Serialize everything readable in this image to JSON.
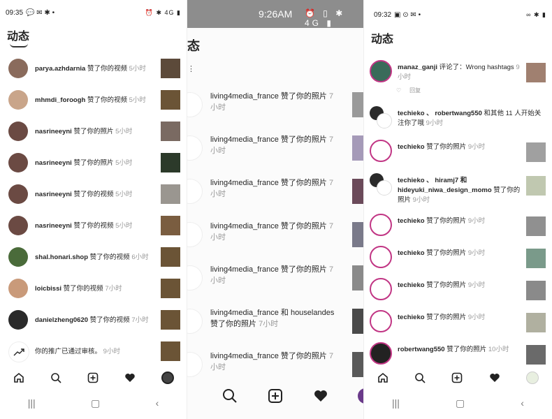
{
  "p1": {
    "status_time": "09:35",
    "status_right": "⏰ ✱ 4G ▮",
    "title": "动态",
    "rows": [
      {
        "user": "parya.azhdarnia",
        "action": "赞了你的视频",
        "time": "5小时",
        "av": "#8a6b5c",
        "img": "#5c4a3a"
      },
      {
        "user": "mhmdi_foroogh",
        "action": "赞了你的视频",
        "time": "5小时",
        "av": "#c9a58a",
        "img": "#6b5436"
      },
      {
        "user": "nasrineeyni",
        "action": "赞了你的照片",
        "time": "5小时",
        "av": "#6b4a43",
        "img": "#7a6a62"
      },
      {
        "user": "nasrineeyni",
        "action": "赞了你的照片",
        "time": "5小时",
        "av": "#6b4a43",
        "img": "#2c3a2a"
      },
      {
        "user": "nasrineeyni",
        "action": "赞了你的视频",
        "time": "5小时",
        "av": "#6b4a43",
        "img": "#9a9690"
      },
      {
        "user": "nasrineeyni",
        "action": "赞了你的视频",
        "time": "5小时",
        "av": "#6b4a43",
        "img": "#7a5d40"
      },
      {
        "user": "shal.honari.shop",
        "action": "赞了你的视频",
        "time": "6小时",
        "av": "#4a6b3a",
        "img": "#6b5436"
      },
      {
        "user": "loicbissi",
        "action": "赞了你的视频",
        "time": "7小时",
        "av": "#c99a7a",
        "img": "#6b5436"
      },
      {
        "user": "danielzheng0620",
        "action": "赞了你的视频",
        "time": "7小时",
        "av": "#2a2a2a",
        "img": "#6b5436"
      },
      {
        "user": "",
        "action": "你的推广已通过审核。",
        "time": "9小时",
        "av": "#ffffff",
        "img": "#6b5436"
      }
    ]
  },
  "p2": {
    "status_time": "9:26AM",
    "status_icons": "⏰ ▯ ✱ 4G ▮",
    "title": "态",
    "rows": [
      {
        "user": "living4media_france",
        "action": "赞了你的照片",
        "time": "7小时",
        "img": "#9a9a9a"
      },
      {
        "user": "living4media_france",
        "action": "赞了你的照片",
        "time": "7小时",
        "img": "#a59ab8"
      },
      {
        "user": "living4media_france",
        "action": "赞了你的照片",
        "time": "7小时",
        "img": "#6b4a5a"
      },
      {
        "user": "living4media_france",
        "action": "赞了你的照片",
        "time": "7小时",
        "img": "#7a7a8a"
      },
      {
        "user": "living4media_france",
        "action": "赞了你的照片",
        "time": "7小时",
        "img": "#8a8a8a"
      },
      {
        "user": "living4media_france 和 houselandes",
        "action": "赞了你的照片",
        "time": "7小时",
        "img": "#4a4a4a"
      },
      {
        "user": "living4media_france",
        "action": "赞了你的照片",
        "time": "7小时",
        "img": "#5a5a5a"
      }
    ]
  },
  "p3": {
    "status_time": "09:32",
    "status_right": "∞ ✱ ▮",
    "title": "动态",
    "rows": [
      {
        "user": "manaz_ganji",
        "action": "评论了：Wrong hashtags",
        "time": "9小时",
        "reply": "回复",
        "img": "#a08070",
        "av": "#3a6b5a"
      },
      {
        "user": "techieko 、 robertwang550",
        "action": "和其他 11 人开始关注你了哦",
        "time": "9小时",
        "img": "",
        "av": "#ffffff"
      },
      {
        "user": "techieko",
        "action": "赞了你的照片",
        "time": "9小时",
        "img": "#a0a0a0",
        "av": "#ffffff"
      },
      {
        "user": "techieko 、 hiramj7 和 hideyuki_niwa_design_momo",
        "action": "赞了你的照片",
        "time": "9小时",
        "img": "#c0c8b0",
        "av": "#ffffff"
      },
      {
        "user": "techieko",
        "action": "赞了你的照片",
        "time": "9小时",
        "img": "#909090",
        "av": "#ffffff"
      },
      {
        "user": "techieko",
        "action": "赞了你的照片",
        "time": "9小时",
        "img": "#7a9a8a",
        "av": "#ffffff"
      },
      {
        "user": "techieko",
        "action": "赞了你的照片",
        "time": "9小时",
        "img": "#8a8a8a",
        "av": "#ffffff"
      },
      {
        "user": "techieko",
        "action": "赞了你的照片",
        "time": "9小时",
        "img": "#b0b0a0",
        "av": "#ffffff"
      },
      {
        "user": "robertwang550",
        "action": "赞了你的照片",
        "time": "10小时",
        "img": "#6a6a6a",
        "av": "#222222"
      }
    ]
  },
  "colors": {
    "gradient_ring": "#c13584",
    "time_gray": "#999999"
  }
}
